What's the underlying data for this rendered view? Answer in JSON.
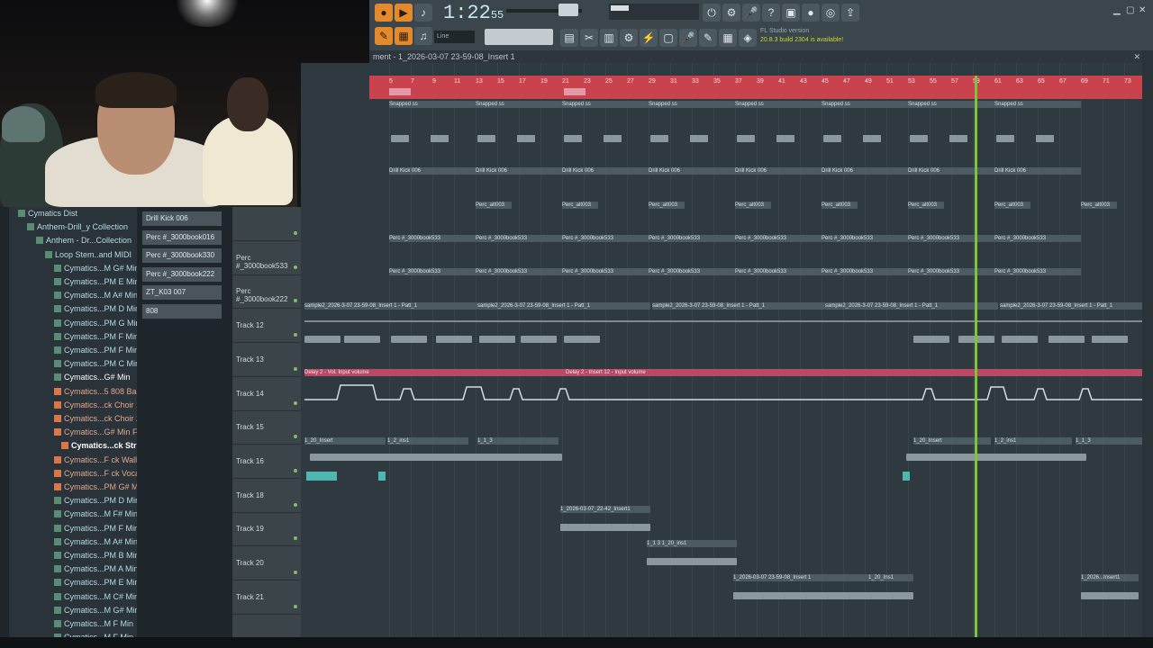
{
  "toolbar": {
    "time": "1:22",
    "time_sub": "55",
    "tempo_label": "Line",
    "hint_text": "FL Studio version",
    "hint_sub": "20.8.3 build 2304 is available!"
  },
  "titlebar": {
    "title": "ment - 1_2026-03-07 23-59-08_Insert 1"
  },
  "browser": {
    "items": [
      {
        "label": "Cymatics Dist",
        "indent": 20,
        "type": "folder"
      },
      {
        "label": "Anthem-Drill_y Collection",
        "indent": 30,
        "type": "folder"
      },
      {
        "label": "Anthem - Dr...Collection",
        "indent": 40,
        "type": "folder"
      },
      {
        "label": "Loop Stem..and MIDI",
        "indent": 50,
        "type": "folder"
      },
      {
        "label": "Cymatics...M G# Min",
        "indent": 60,
        "type": "folder"
      },
      {
        "label": "Cymatics...PM E Min",
        "indent": 60,
        "type": "folder"
      },
      {
        "label": "Cymatics...M A# Min",
        "indent": 60,
        "type": "folder"
      },
      {
        "label": "Cymatics...PM D Min",
        "indent": 60,
        "type": "folder"
      },
      {
        "label": "Cymatics...PM G Min",
        "indent": 60,
        "type": "folder"
      },
      {
        "label": "Cymatics...PM F Min",
        "indent": 60,
        "type": "folder"
      },
      {
        "label": "Cymatics...PM F Min",
        "indent": 60,
        "type": "folder"
      },
      {
        "label": "Cymatics...PM C Min",
        "indent": 60,
        "type": "folder"
      },
      {
        "label": "Cymatics...G# Min",
        "indent": 60,
        "type": "folder-open"
      },
      {
        "label": "Cymatics...5 808 Bass",
        "indent": 60,
        "type": "audio"
      },
      {
        "label": "Cymatics...ck Choir 1",
        "indent": 60,
        "type": "audio"
      },
      {
        "label": "Cymatics...ck Choir 2",
        "indent": 60,
        "type": "audio"
      },
      {
        "label": "Cymatics...G# Min F8",
        "indent": 60,
        "type": "audio"
      },
      {
        "label": "Cymatics...ck Strings",
        "indent": 68,
        "type": "audio-selected"
      },
      {
        "label": "Cymatics...F ck Wallet",
        "indent": 60,
        "type": "audio"
      },
      {
        "label": "Cymatics...F ck Vocals",
        "indent": 60,
        "type": "audio"
      },
      {
        "label": "Cymatics...PM G# Min",
        "indent": 60,
        "type": "audio"
      },
      {
        "label": "Cymatics...PM D Min",
        "indent": 60,
        "type": "folder"
      },
      {
        "label": "Cymatics...M F# Min",
        "indent": 60,
        "type": "folder"
      },
      {
        "label": "Cymatics...PM F Min",
        "indent": 60,
        "type": "folder"
      },
      {
        "label": "Cymatics...M A# Min",
        "indent": 60,
        "type": "folder"
      },
      {
        "label": "Cymatics...PM B Min",
        "indent": 60,
        "type": "folder"
      },
      {
        "label": "Cymatics...PM A Min",
        "indent": 60,
        "type": "folder"
      },
      {
        "label": "Cymatics...PM E Min",
        "indent": 60,
        "type": "folder"
      },
      {
        "label": "Cymatics...M C# Min",
        "indent": 60,
        "type": "folder"
      },
      {
        "label": "Cymatics...M G# Min",
        "indent": 60,
        "type": "folder"
      },
      {
        "label": "Cymatics...M F Min",
        "indent": 60,
        "type": "folder"
      },
      {
        "label": "Cymatics...M F Min",
        "indent": 60,
        "type": "folder"
      }
    ]
  },
  "channels": [
    "Drill Kick 006",
    "Perc #_3000book016",
    "Perc #_3000book330",
    "Perc #_3000book222",
    "ZT_K03 007",
    "808"
  ],
  "tracks": [
    {
      "label": ""
    },
    {
      "label": "Perc #_3000book533"
    },
    {
      "label": "Perc #_3000book222"
    },
    {
      "label": "Track 12"
    },
    {
      "label": "Track 13"
    },
    {
      "label": "Track 14"
    },
    {
      "label": "Track 15"
    },
    {
      "label": "Track 16"
    },
    {
      "label": "Track 18"
    },
    {
      "label": "Track 19"
    },
    {
      "label": "Track 20"
    },
    {
      "label": "Track 21"
    }
  ],
  "ruler_numbers": [
    "5",
    "7",
    "9",
    "11",
    "13",
    "15",
    "17",
    "19",
    "21",
    "23",
    "25",
    "27",
    "29",
    "31",
    "33",
    "35",
    "37",
    "39",
    "41",
    "43",
    "45",
    "47",
    "49",
    "51",
    "53",
    "55",
    "57",
    "59",
    "61",
    "63",
    "65",
    "67",
    "69",
    "71",
    "73",
    "75"
  ],
  "clips": {
    "snapped": "Snapped ss",
    "kick": "Drill Kick 006",
    "perc_a": "Perc_alt003",
    "perc_b": "Perc #_3000book533",
    "track12_pattern": "sample2_2026-3-07 23-59-08_Insert 1 - Patt_1",
    "track14_pattern": "Delay 2 - Vol. Input volume",
    "track14_pattern2": "Delay 2 - Insert 12 - Input volume",
    "track16_a": "1_20_Insert",
    "track16_b": "1_2_ins1",
    "track16_c": "1_1_3",
    "track19": "1_2026-03-07_22-42_Insert1",
    "track20": "1_1 3 1_20_ins1",
    "track21": "1_2026-03-07 23-59-08_Insert 1",
    "track21_b": "1_20_Ins1",
    "track21_c": "1_2026...Insert1"
  },
  "colors": {
    "accent_orange": "#e58a2c",
    "ruler_red": "#c9434f",
    "playhead_green": "#7ec33b",
    "automation_pink": "#b84a66"
  }
}
